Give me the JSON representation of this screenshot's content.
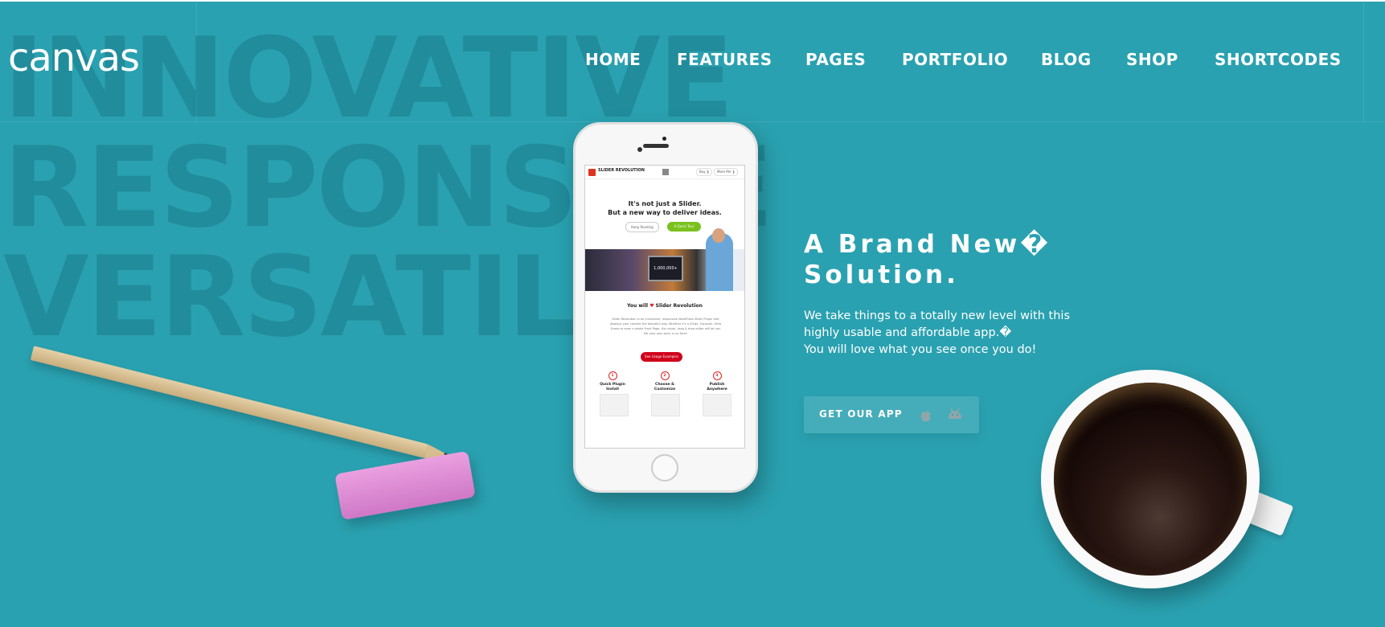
{
  "brand": {
    "logo": "canvas"
  },
  "background_words": [
    "INNOVATIVE",
    "RESPONSIVE",
    "VERSATILE"
  ],
  "nav": {
    "items": [
      {
        "label": "HOME"
      },
      {
        "label": "FEATURES"
      },
      {
        "label": "PAGES"
      },
      {
        "label": "PORTFOLIO"
      },
      {
        "label": "BLOG"
      },
      {
        "label": "SHOP"
      },
      {
        "label": "SHORTCODES"
      }
    ]
  },
  "phone": {
    "screen": {
      "logo": "SLIDER REVOLUTION",
      "pill_buy": "Buy ❯",
      "pill_more": "More Per ❯",
      "headline_1": "It's not just a Slider.",
      "headline_2": "But a new way to deliver ideas.",
      "button_1": "Keep Reading",
      "button_2": "A Quick Tour",
      "monitor_text": "1,000,000+",
      "love_prefix": "You will",
      "love_heart": "♥",
      "love_suffix": "Slider Revolution",
      "paragraph": "Slider Revolution is an innovative, responsive WordPress Slider Plugin that displays your content the beautiful way. Whether it's a Slider, Carousel, Hero Scene or even a whole Front Page, the visual, drag & drop editor will let you tell your own story in no time!",
      "examples_button": "See Usage Examples",
      "steps": [
        {
          "num": "1",
          "label": "Quick Plugin Install"
        },
        {
          "num": "2",
          "label": "Choose & Customize"
        },
        {
          "num": "3",
          "label": "Publish Anywhere"
        }
      ]
    }
  },
  "hero": {
    "title_line1": "A Brand New�",
    "title_line2": "Solution.",
    "desc_line1": "We take things to a totally new level with this",
    "desc_line2": "highly usable and affordable app.�",
    "desc_line3": "You will love what you see once you do!",
    "cta_label": "GET OUR APP",
    "cta_icons": [
      "apple-icon",
      "android-icon"
    ]
  },
  "colors": {
    "background": "#2aa1b0",
    "text": "#ffffff",
    "accent_red": "#d0021b",
    "accent_green": "#7bc11e"
  }
}
